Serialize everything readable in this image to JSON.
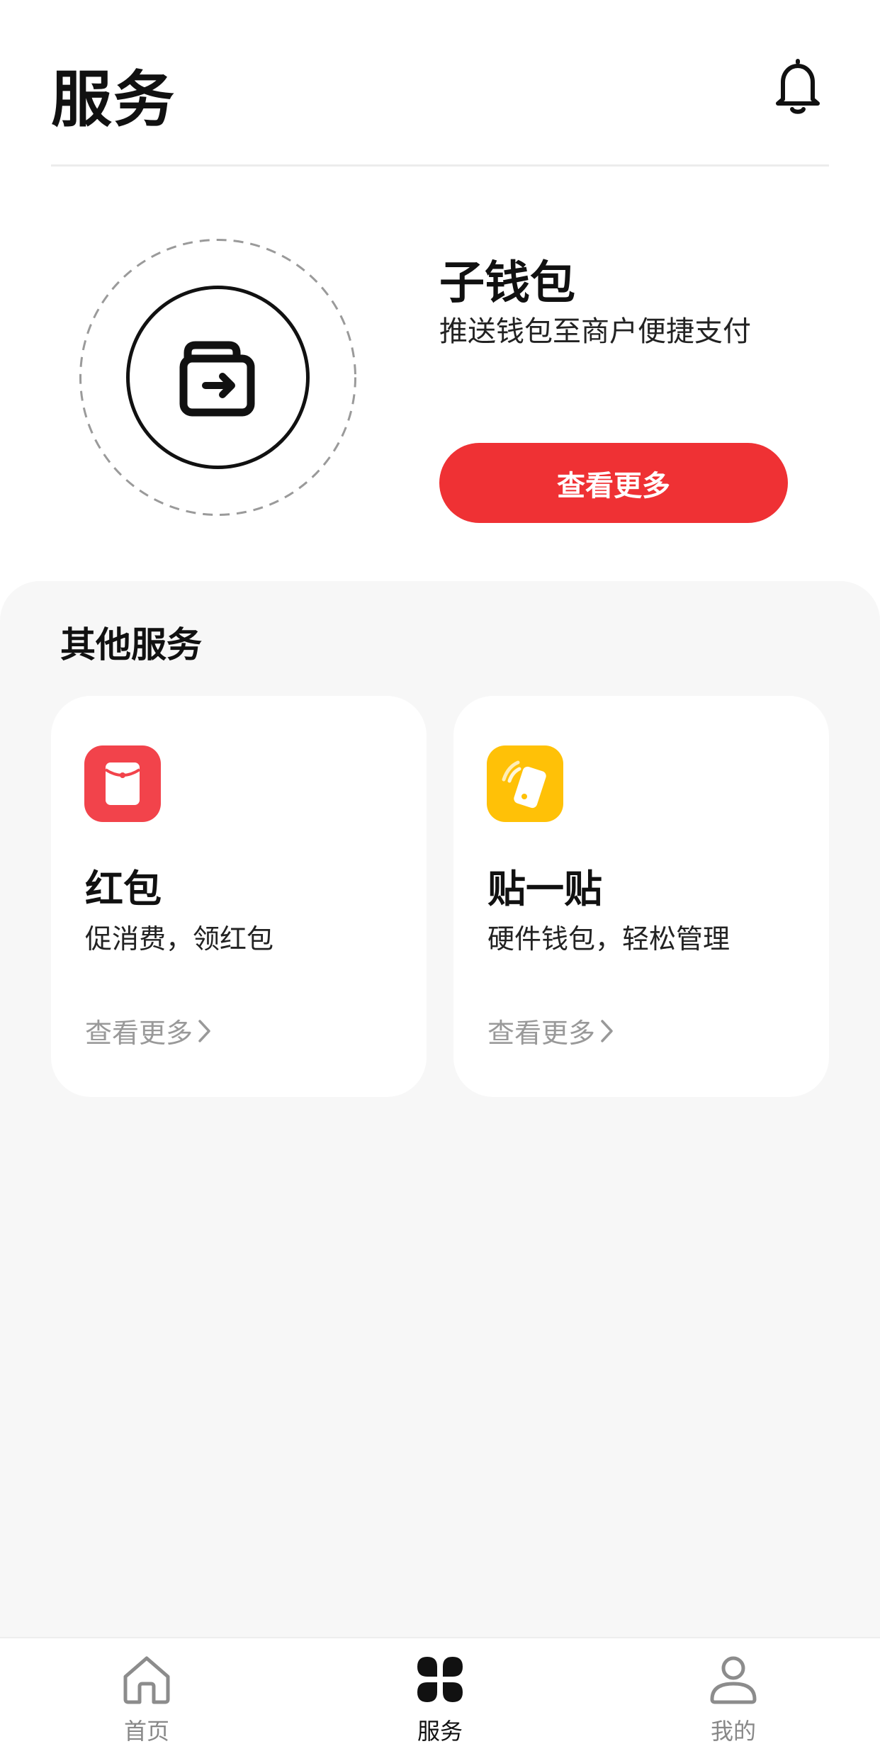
{
  "header": {
    "title": "服务"
  },
  "hero": {
    "title": "子钱包",
    "subtitle": "推送钱包至商户便捷支付",
    "button_label": "查看更多"
  },
  "other_services": {
    "section_title": "其他服务",
    "cards": [
      {
        "title": "红包",
        "description": "促消费，领红包",
        "more_label": "查看更多",
        "icon": "red-envelope-icon",
        "icon_color": "#f2434b"
      },
      {
        "title": "贴一贴",
        "description": "硬件钱包，轻松管理",
        "more_label": "查看更多",
        "icon": "tap-card-icon",
        "icon_color": "#ffc107"
      }
    ]
  },
  "bottom_nav": {
    "items": [
      {
        "label": "首页",
        "icon": "home-icon",
        "active": false
      },
      {
        "label": "服务",
        "icon": "services-grid-icon",
        "active": true
      },
      {
        "label": "我的",
        "icon": "profile-icon",
        "active": false
      }
    ]
  },
  "colors": {
    "accent": "#ef3134",
    "panel_background": "#f7f7f7",
    "muted_text": "#999999"
  }
}
